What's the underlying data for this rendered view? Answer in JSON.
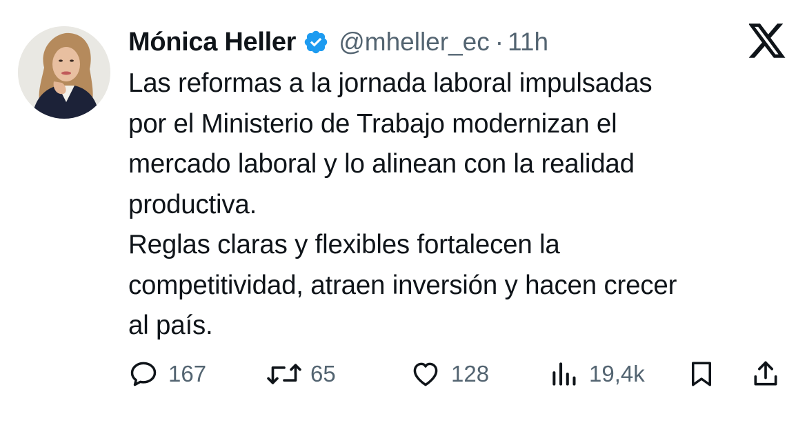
{
  "tweet": {
    "author": {
      "display_name": "Mónica Heller",
      "handle": "@mheller_ec",
      "verified_icon": "verified-badge-icon",
      "avatar": "profile-photo"
    },
    "separator": "·",
    "timestamp": "11h",
    "platform_logo": "x-logo-icon",
    "text_lines": [
      "Las reformas a la jornada laboral impulsadas",
      "por el Ministerio de Trabajo modernizan el",
      "mercado laboral y lo alinean con la realidad",
      "productiva.",
      "Reglas claras y flexibles fortalecen la",
      "competitividad, atraen inversión y hacen crecer",
      "al país."
    ],
    "actions": {
      "replies": {
        "icon": "reply-icon",
        "count": "167"
      },
      "reposts": {
        "icon": "repost-icon",
        "count": "65"
      },
      "likes": {
        "icon": "heart-icon",
        "count": "128"
      },
      "views": {
        "icon": "views-icon",
        "count": "19,4k"
      },
      "bookmark": {
        "icon": "bookmark-icon"
      },
      "share": {
        "icon": "share-icon"
      }
    },
    "colors": {
      "text": "#0f1419",
      "secondary": "#536471",
      "verified": "#1d9bf0"
    }
  }
}
